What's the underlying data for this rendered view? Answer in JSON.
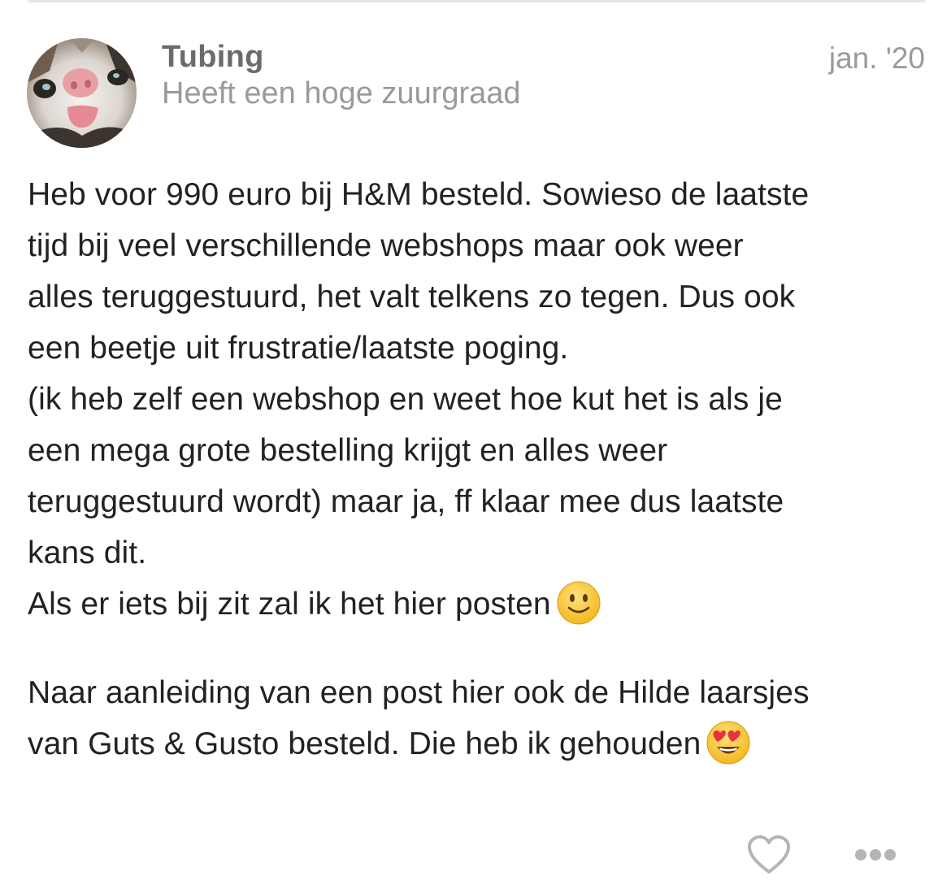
{
  "post": {
    "author": {
      "username": "Tubing",
      "title": "Heeft een hoge zuurgraad",
      "avatar_icon": "cat-face-avatar"
    },
    "date": "jan. '20",
    "body": {
      "paragraph1_lines": [
        "Heb voor 990 euro bij H&M besteld. Sowieso de laatste",
        "tijd bij veel verschillende webshops maar ook weer",
        "alles teruggestuurd, het valt telkens zo tegen. Dus ook",
        "een beetje uit frustratie/laatste poging.",
        "(ik heb zelf een webshop en weet hoe kut het is als je",
        "een mega grote bestelling krijgt en alles weer",
        "teruggestuurd wordt) maar ja, ff klaar mee dus laatste",
        "kans dit.",
        "Als er iets bij zit zal ik het hier posten"
      ],
      "paragraph1_emoji": "slightly-smiling-face-emoji",
      "paragraph2_lines": [
        "Naar aanleiding van een post hier ook de Hilde laarsjes",
        "van Guts & Gusto besteld. Die heb ik gehouden"
      ],
      "paragraph2_emoji": "heart-eyes-face-emoji"
    },
    "actions": {
      "like_icon": "heart-outline-icon",
      "more_icon": "more-dots-icon"
    }
  },
  "colors": {
    "text": "#222222",
    "username": "#6b6b6b",
    "muted": "#9a9a9a",
    "icon": "#b5b5b5",
    "divider": "#e6e6e6",
    "emoji_yellow": "#f7c02c",
    "heart_red": "#e8323c"
  }
}
